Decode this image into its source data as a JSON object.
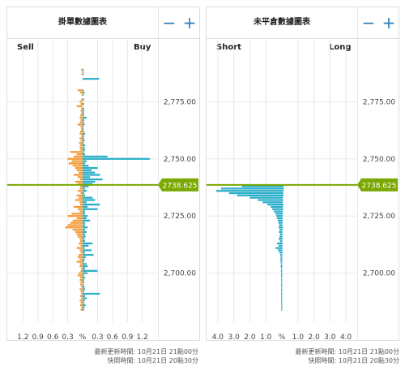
{
  "colors": {
    "buy": "#2aaec9",
    "sell": "#f59a35",
    "current_price": "#7aa800",
    "grid": "#e8e8e8",
    "zoom": "#2a7ab8"
  },
  "icons": {
    "zoom_out": "minus-icon",
    "zoom_in": "plus-icon"
  },
  "orderbook": {
    "title": "掛單數據圖表",
    "left_label": "Sell",
    "right_label": "Buy",
    "zoom_out_label": "−",
    "zoom_in_label": "+",
    "updated": "最新更新時間: 10月21日 21點00分",
    "snapshot": "快照時間: 10月21日 20點30分"
  },
  "positions": {
    "title": "未平倉數據圖表",
    "left_label": "Short",
    "right_label": "Long",
    "zoom_out_label": "−",
    "zoom_in_label": "+",
    "updated": "最新更新時間: 10月21日 21點00分",
    "snapshot": "快照時間: 10月21日 20點30分"
  },
  "chart_data": [
    {
      "type": "bar",
      "title": "掛單數據圖表",
      "orientation": "horizontal",
      "x_tick_labels": [
        "1.2",
        "0.9",
        "0.6",
        "0.3",
        "%",
        "0.3",
        "0.6",
        "0.9",
        "1.2"
      ],
      "x_range_percent": [
        -1.45,
        1.45
      ],
      "y_tick_labels": [
        "2,775.00",
        "2,750.00",
        "2,725.00",
        "2,700.00"
      ],
      "y_ticks": [
        2775,
        2750,
        2725,
        2700
      ],
      "y_range": [
        2680,
        2795
      ],
      "current_price": 2738.625,
      "current_price_label": "2738.625",
      "price_step": 0.8,
      "series": [
        {
          "name": "Sell",
          "side": "left",
          "color": "#f59a35"
        },
        {
          "name": "Buy",
          "side": "right",
          "color": "#2aaec9"
        }
      ],
      "levels": [
        {
          "price": 2789,
          "sell": 0.03,
          "buy": 0.02
        },
        {
          "price": 2788,
          "sell": 0.01,
          "buy": 0.02
        },
        {
          "price": 2787,
          "sell": 0.02,
          "buy": 0.02
        },
        {
          "price": 2786,
          "sell": 0.0,
          "buy": 0.0
        },
        {
          "price": 2785,
          "sell": 0.0,
          "buy": 0.33
        },
        {
          "price": 2782,
          "sell": 0.0,
          "buy": 0.0
        },
        {
          "price": 2780,
          "sell": 0.1,
          "buy": 0.02
        },
        {
          "price": 2779,
          "sell": 0.05,
          "buy": 0.04
        },
        {
          "price": 2778,
          "sell": 0.02,
          "buy": 0.02
        },
        {
          "price": 2776,
          "sell": 0.03,
          "buy": 0.03
        },
        {
          "price": 2775,
          "sell": 0.06,
          "buy": 0.0
        },
        {
          "price": 2774,
          "sell": 0.04,
          "buy": 0.03
        },
        {
          "price": 2773,
          "sell": 0.12,
          "buy": 0.0
        },
        {
          "price": 2772,
          "sell": 0.03,
          "buy": 0.03
        },
        {
          "price": 2771,
          "sell": 0.04,
          "buy": 0.03
        },
        {
          "price": 2770,
          "sell": 0.03,
          "buy": 0.03
        },
        {
          "price": 2769,
          "sell": 0.05,
          "buy": 0.03
        },
        {
          "price": 2768,
          "sell": 0.06,
          "buy": 0.08
        },
        {
          "price": 2767,
          "sell": 0.04,
          "buy": 0.03
        },
        {
          "price": 2766,
          "sell": 0.06,
          "buy": 0.03
        },
        {
          "price": 2765,
          "sell": 0.1,
          "buy": 0.04
        },
        {
          "price": 2764,
          "sell": 0.04,
          "buy": 0.02
        },
        {
          "price": 2763,
          "sell": 0.03,
          "buy": 0.02
        },
        {
          "price": 2762,
          "sell": 0.05,
          "buy": 0.03
        },
        {
          "price": 2761,
          "sell": 0.06,
          "buy": 0.05
        },
        {
          "price": 2760,
          "sell": 0.03,
          "buy": 0.03
        },
        {
          "price": 2759,
          "sell": 0.06,
          "buy": 0.03
        },
        {
          "price": 2758,
          "sell": 0.04,
          "buy": 0.04
        },
        {
          "price": 2757,
          "sell": 0.07,
          "buy": 0.02
        },
        {
          "price": 2756,
          "sell": 0.05,
          "buy": 0.05
        },
        {
          "price": 2755,
          "sell": 0.06,
          "buy": 0.04
        },
        {
          "price": 2754,
          "sell": 0.05,
          "buy": 0.05
        },
        {
          "price": 2753,
          "sell": 0.25,
          "buy": 0.03
        },
        {
          "price": 2752,
          "sell": 0.12,
          "buy": 0.05
        },
        {
          "price": 2751,
          "sell": 0.18,
          "buy": 0.5
        },
        {
          "price": 2750,
          "sell": 0.3,
          "buy": 1.35
        },
        {
          "price": 2749,
          "sell": 0.22,
          "buy": 0.08
        },
        {
          "price": 2748,
          "sell": 0.28,
          "buy": 0.05
        },
        {
          "price": 2747,
          "sell": 0.2,
          "buy": 0.12
        },
        {
          "price": 2746,
          "sell": 0.15,
          "buy": 0.3
        },
        {
          "price": 2745,
          "sell": 0.12,
          "buy": 0.18
        },
        {
          "price": 2744,
          "sell": 0.08,
          "buy": 0.25
        },
        {
          "price": 2743,
          "sell": 0.18,
          "buy": 0.35
        },
        {
          "price": 2742,
          "sell": 0.1,
          "buy": 0.15
        },
        {
          "price": 2741,
          "sell": 0.05,
          "buy": 0.4
        },
        {
          "price": 2740,
          "sell": 0.15,
          "buy": 0.25
        },
        {
          "price": 2739,
          "sell": 0.1,
          "buy": 0.2
        },
        {
          "price": 2738,
          "sell": 0.05,
          "buy": 0.12
        },
        {
          "price": 2737,
          "sell": 0.06,
          "buy": 0.05
        },
        {
          "price": 2736,
          "sell": 0.1,
          "buy": 0.08
        },
        {
          "price": 2735,
          "sell": 0.04,
          "buy": 0.03
        },
        {
          "price": 2734,
          "sell": 0.12,
          "buy": 0.05
        },
        {
          "price": 2733,
          "sell": 0.08,
          "buy": 0.2
        },
        {
          "price": 2732,
          "sell": 0.15,
          "buy": 0.25
        },
        {
          "price": 2731,
          "sell": 0.06,
          "buy": 0.08
        },
        {
          "price": 2730,
          "sell": 0.05,
          "buy": 0.35
        },
        {
          "price": 2729,
          "sell": 0.18,
          "buy": 0.1
        },
        {
          "price": 2728,
          "sell": 0.1,
          "buy": 0.3
        },
        {
          "price": 2727,
          "sell": 0.06,
          "buy": 0.05
        },
        {
          "price": 2726,
          "sell": 0.22,
          "buy": 0.05
        },
        {
          "price": 2725,
          "sell": 0.3,
          "buy": 0.1
        },
        {
          "price": 2724,
          "sell": 0.12,
          "buy": 0.08
        },
        {
          "price": 2723,
          "sell": 0.2,
          "buy": 0.15
        },
        {
          "price": 2722,
          "sell": 0.25,
          "buy": 0.05
        },
        {
          "price": 2721,
          "sell": 0.3,
          "buy": 0.05
        },
        {
          "price": 2720,
          "sell": 0.35,
          "buy": 0.1
        },
        {
          "price": 2719,
          "sell": 0.2,
          "buy": 0.05
        },
        {
          "price": 2718,
          "sell": 0.15,
          "buy": 0.08
        },
        {
          "price": 2717,
          "sell": 0.12,
          "buy": 0.05
        },
        {
          "price": 2716,
          "sell": 0.1,
          "buy": 0.06
        },
        {
          "price": 2715,
          "sell": 0.06,
          "buy": 0.04
        },
        {
          "price": 2714,
          "sell": 0.05,
          "buy": 0.05
        },
        {
          "price": 2713,
          "sell": 0.08,
          "buy": 0.2
        },
        {
          "price": 2712,
          "sell": 0.04,
          "buy": 0.12
        },
        {
          "price": 2711,
          "sell": 0.12,
          "buy": 0.04
        },
        {
          "price": 2710,
          "sell": 0.06,
          "buy": 0.18
        },
        {
          "price": 2709,
          "sell": 0.04,
          "buy": 0.05
        },
        {
          "price": 2708,
          "sell": 0.08,
          "buy": 0.22
        },
        {
          "price": 2707,
          "sell": 0.1,
          "buy": 0.06
        },
        {
          "price": 2706,
          "sell": 0.06,
          "buy": 0.04
        },
        {
          "price": 2705,
          "sell": 0.12,
          "buy": 0.03
        },
        {
          "price": 2704,
          "sell": 0.05,
          "buy": 0.08
        },
        {
          "price": 2703,
          "sell": 0.06,
          "buy": 0.1
        },
        {
          "price": 2702,
          "sell": 0.03,
          "buy": 0.05
        },
        {
          "price": 2701,
          "sell": 0.04,
          "buy": 0.3
        },
        {
          "price": 2700,
          "sell": 0.08,
          "buy": 0.1
        },
        {
          "price": 2699,
          "sell": 0.1,
          "buy": 0.03
        },
        {
          "price": 2698,
          "sell": 0.05,
          "buy": 0.05
        },
        {
          "price": 2697,
          "sell": 0.06,
          "buy": 0.03
        },
        {
          "price": 2696,
          "sell": 0.04,
          "buy": 0.03
        },
        {
          "price": 2695,
          "sell": 0.05,
          "buy": 0.02
        },
        {
          "price": 2694,
          "sell": 0.03,
          "buy": 0.04
        },
        {
          "price": 2693,
          "sell": 0.06,
          "buy": 0.05
        },
        {
          "price": 2692,
          "sell": 0.04,
          "buy": 0.03
        },
        {
          "price": 2691,
          "sell": 0.03,
          "buy": 0.35
        },
        {
          "price": 2690,
          "sell": 0.05,
          "buy": 0.05
        },
        {
          "price": 2689,
          "sell": 0.03,
          "buy": 0.08
        },
        {
          "price": 2688,
          "sell": 0.06,
          "buy": 0.04
        },
        {
          "price": 2687,
          "sell": 0.04,
          "buy": 0.03
        },
        {
          "price": 2686,
          "sell": 0.05,
          "buy": 0.06
        },
        {
          "price": 2685,
          "sell": 0.03,
          "buy": 0.04
        },
        {
          "price": 2684,
          "sell": 0.04,
          "buy": 0.03
        }
      ]
    },
    {
      "type": "bar",
      "title": "未平倉數據圖表",
      "orientation": "horizontal",
      "x_tick_labels": [
        "4.0",
        "3.0",
        "2.0",
        "1.0",
        "%",
        "1.0",
        "2.0",
        "3.0",
        "4.0"
      ],
      "x_range_percent": [
        -4.5,
        4.5
      ],
      "y_tick_labels": [
        "2,775.00",
        "2,750.00",
        "2,725.00",
        "2,700.00"
      ],
      "y_ticks": [
        2775,
        2750,
        2725,
        2700
      ],
      "y_range": [
        2680,
        2795
      ],
      "current_price": 2738.625,
      "current_price_label": "2738.625",
      "price_step": 0.8,
      "series": [
        {
          "name": "Short",
          "side": "left",
          "color": "#2aaec9"
        },
        {
          "name": "Long",
          "side": "right",
          "color": "#2aaec9"
        }
      ],
      "levels": [
        {
          "price": 2738,
          "short": 2.5,
          "long": 0.1
        },
        {
          "price": 2737,
          "short": 3.8,
          "long": 0.12
        },
        {
          "price": 2736,
          "short": 4.1,
          "long": 0.1
        },
        {
          "price": 2735,
          "short": 3.3,
          "long": 0.08
        },
        {
          "price": 2734,
          "short": 2.8,
          "long": 0.1
        },
        {
          "price": 2733,
          "short": 2.0,
          "long": 0.06
        },
        {
          "price": 2732,
          "short": 1.5,
          "long": 0.08
        },
        {
          "price": 2731,
          "short": 1.2,
          "long": 0.05
        },
        {
          "price": 2730,
          "short": 0.9,
          "long": 0.1
        },
        {
          "price": 2729,
          "short": 0.7,
          "long": 0.06
        },
        {
          "price": 2728,
          "short": 0.6,
          "long": 0.08
        },
        {
          "price": 2727,
          "short": 0.5,
          "long": 0.05
        },
        {
          "price": 2726,
          "short": 0.4,
          "long": 0.06
        },
        {
          "price": 2725,
          "short": 0.35,
          "long": 0.04
        },
        {
          "price": 2724,
          "short": 0.3,
          "long": 0.05
        },
        {
          "price": 2723,
          "short": 0.25,
          "long": 0.04
        },
        {
          "price": 2722,
          "short": 0.22,
          "long": 0.05
        },
        {
          "price": 2721,
          "short": 0.18,
          "long": 0.04
        },
        {
          "price": 2720,
          "short": 0.2,
          "long": 0.06
        },
        {
          "price": 2719,
          "short": 0.15,
          "long": 0.04
        },
        {
          "price": 2718,
          "short": 0.18,
          "long": 0.03
        },
        {
          "price": 2717,
          "short": 0.12,
          "long": 0.04
        },
        {
          "price": 2716,
          "short": 0.15,
          "long": 0.03
        },
        {
          "price": 2715,
          "short": 0.2,
          "long": 0.05
        },
        {
          "price": 2714,
          "short": 0.12,
          "long": 0.03
        },
        {
          "price": 2713,
          "short": 0.3,
          "long": 0.04
        },
        {
          "price": 2712,
          "short": 0.2,
          "long": 0.03
        },
        {
          "price": 2711,
          "short": 0.4,
          "long": 0.04
        },
        {
          "price": 2710,
          "short": 0.25,
          "long": 0.03
        },
        {
          "price": 2709,
          "short": 0.15,
          "long": 0.04
        },
        {
          "price": 2708,
          "short": 0.1,
          "long": 0.03
        },
        {
          "price": 2707,
          "short": 0.08,
          "long": 0.02
        },
        {
          "price": 2706,
          "short": 0.1,
          "long": 0.03
        },
        {
          "price": 2705,
          "short": 0.08,
          "long": 0.02
        },
        {
          "price": 2704,
          "short": 0.06,
          "long": 0.02
        },
        {
          "price": 2703,
          "short": 0.08,
          "long": 0.03
        },
        {
          "price": 2702,
          "short": 0.05,
          "long": 0.02
        },
        {
          "price": 2701,
          "short": 0.06,
          "long": 0.02
        },
        {
          "price": 2700,
          "short": 0.05,
          "long": 0.02
        },
        {
          "price": 2699,
          "short": 0.06,
          "long": 0.02
        },
        {
          "price": 2698,
          "short": 0.04,
          "long": 0.02
        },
        {
          "price": 2697,
          "short": 0.05,
          "long": 0.02
        },
        {
          "price": 2696,
          "short": 0.04,
          "long": 0.02
        },
        {
          "price": 2695,
          "short": 0.06,
          "long": 0.02
        },
        {
          "price": 2694,
          "short": 0.04,
          "long": 0.02
        },
        {
          "price": 2693,
          "short": 0.05,
          "long": 0.02
        },
        {
          "price": 2692,
          "short": 0.04,
          "long": 0.02
        },
        {
          "price": 2691,
          "short": 0.05,
          "long": 0.02
        },
        {
          "price": 2690,
          "short": 0.04,
          "long": 0.02
        },
        {
          "price": 2689,
          "short": 0.05,
          "long": 0.02
        },
        {
          "price": 2688,
          "short": 0.04,
          "long": 0.02
        },
        {
          "price": 2687,
          "short": 0.05,
          "long": 0.02
        },
        {
          "price": 2686,
          "short": 0.04,
          "long": 0.02
        },
        {
          "price": 2685,
          "short": 0.05,
          "long": 0.02
        },
        {
          "price": 2684,
          "short": 0.04,
          "long": 0.02
        }
      ]
    }
  ]
}
